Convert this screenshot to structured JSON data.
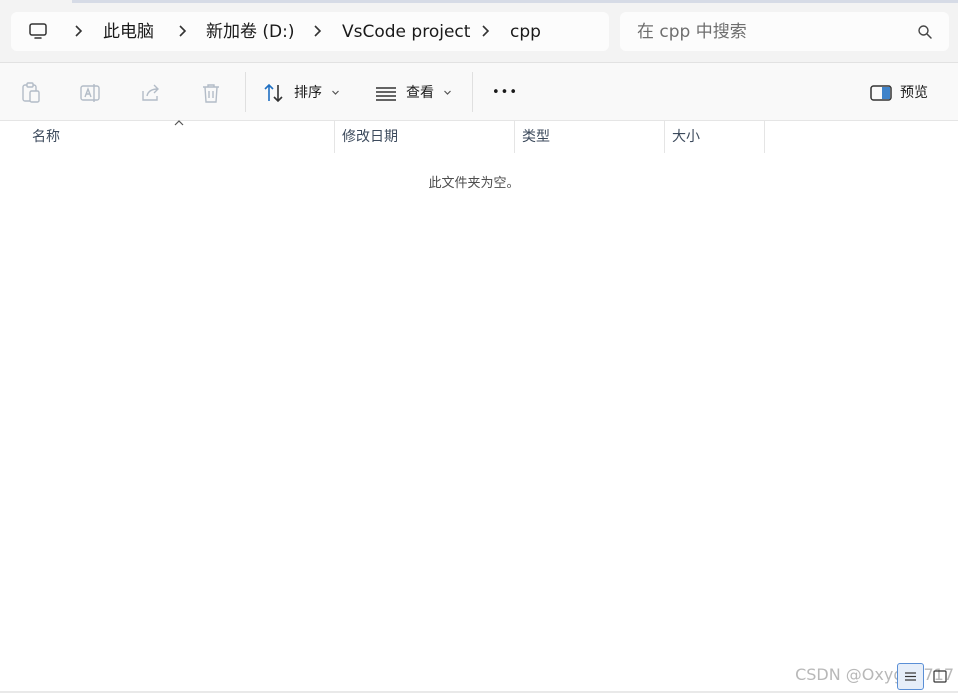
{
  "address_bar": {
    "crumbs": [
      "此电脑",
      "新加卷 (D:)",
      "VsCode project",
      "cpp"
    ]
  },
  "search": {
    "placeholder": "在 cpp 中搜索"
  },
  "toolbar": {
    "sort_label": "排序",
    "view_label": "查看",
    "more_label": "•••",
    "preview_label": "预览"
  },
  "columns": {
    "name": "名称",
    "modified": "修改日期",
    "type": "类型",
    "size": "大小"
  },
  "empty_message": "此文件夹为空。",
  "watermark": "CSDN @Oxygen717",
  "colors": {
    "accent": "#1f6fc2",
    "disabled_icon": "#b3bcc7",
    "view_active": "#e6eef9"
  }
}
